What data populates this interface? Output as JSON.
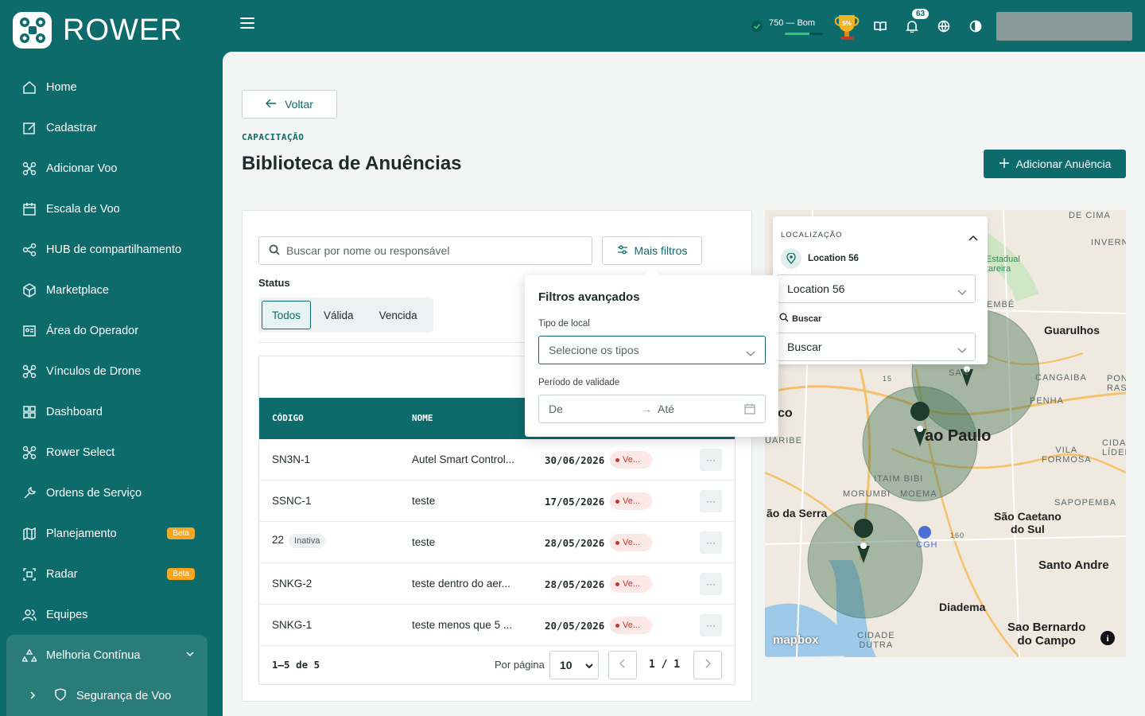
{
  "app": {
    "logo_text": "ROWER"
  },
  "sidebar": {
    "items": [
      {
        "label": "Home",
        "icon": "home-icon"
      },
      {
        "label": "Cadastrar",
        "icon": "edit-icon"
      },
      {
        "label": "Adicionar Voo",
        "icon": "drone-icon"
      },
      {
        "label": "Escala de Voo",
        "icon": "calendar-icon"
      },
      {
        "label": "HUB de compartilhamento",
        "icon": "share-icon"
      },
      {
        "label": "Marketplace",
        "icon": "box-icon"
      },
      {
        "label": "Área do Operador",
        "icon": "id-card-icon"
      },
      {
        "label": "Vínculos de Drone",
        "icon": "drone-icon"
      },
      {
        "label": "Dashboard",
        "icon": "grid-icon"
      },
      {
        "label": "Rower Select",
        "icon": "drone-icon"
      },
      {
        "label": "Ordens de Serviço",
        "icon": "wrench-icon"
      },
      {
        "label": "Planejamento",
        "icon": "map-icon",
        "badge": "Beta"
      },
      {
        "label": "Radar",
        "icon": "radar-icon",
        "badge": "Beta"
      },
      {
        "label": "Equipes",
        "icon": "users-icon"
      }
    ],
    "group": {
      "label": "Melhoria Contínua",
      "sub_item": "Segurança de Voo"
    }
  },
  "topbar": {
    "score_text": "750 — Bom",
    "score_fraction": 0.65,
    "trophy_text": "5%",
    "notifications_count": "63"
  },
  "main": {
    "back_label": "Voltar",
    "eyebrow": "CAPACITAÇÃO",
    "title": "Biblioteca de Anuências",
    "add_label": "Adicionar Anuência",
    "search_placeholder": "Buscar por nome ou responsável",
    "more_filters_label": "Mais filtros",
    "status_label": "Status",
    "status_tabs": [
      "Todos",
      "Válida",
      "Vencida"
    ],
    "table": {
      "headers": [
        "CÓDIGO",
        "NOME"
      ],
      "rows": [
        {
          "code": "SN3N-1",
          "name": "Autel Smart Control...",
          "date": "30/06/2026",
          "status": "Ve..."
        },
        {
          "code": "SSNC-1",
          "name": "teste",
          "date": "17/05/2026",
          "status": "Ve..."
        },
        {
          "code": "22",
          "tag": "Inativa",
          "name": "teste",
          "date": "28/05/2026",
          "status": "Ve..."
        },
        {
          "code": "SNKG-2",
          "name": "teste dentro do aer...",
          "date": "28/05/2026",
          "status": "Ve..."
        },
        {
          "code": "SNKG-1",
          "name": "teste menos que 5 ...",
          "date": "20/05/2026",
          "status": "Ve..."
        }
      ],
      "actions_label": "···"
    },
    "footer": {
      "count": "1–5 de 5",
      "per_page_label": "Por página",
      "per_page": "10",
      "pages": "1 / 1"
    }
  },
  "popover": {
    "title": "Filtros avançados",
    "type_label": "Tipo de local",
    "type_placeholder": "Selecione os tipos",
    "period_label": "Período de validade",
    "from_placeholder": "De",
    "to_placeholder": "Até"
  },
  "map": {
    "panel_eyebrow": "LOCALIZAÇÃO",
    "location_label": "Location 56",
    "location_value": "Location 56",
    "search_label": "Buscar",
    "search_value": "Buscar",
    "labels": {
      "guarulhos": "Guarulhos",
      "sao_paulo": "ao Paulo",
      "sao_caetano": "São Caetano\ndo Sul",
      "santo_andre": "Santo Andre",
      "diadema": "Diadema",
      "sao_bernardo": "Sao Bernardo\ndo Campo",
      "serra": "ão da Serra",
      "co": "co",
      "itaim": "ITAIM BIBI",
      "morumbi": "MORUMBI",
      "moema": "MOEMA",
      "cangaiba": "CANGAIBA",
      "penha": "PENHA",
      "vila_formosa": "VILA\nFORMOSA",
      "sapopemba": "SAPOPEMBA",
      "cidade_dutra": "CIDADE\nDUTRA",
      "cgh": "CGH",
      "de_cima": "DE CIMA",
      "inverno": "INVERN",
      "estadual": "Estadual\ntareira",
      "mapbox": "mapbox",
      "road_15": "15",
      "road_160": "160",
      "san": "SAN",
      "uaribe": "UARIBE",
      "cidade_lider": "CIDAD\nLÍDER",
      "pon": "PON\nRAS",
      "embe": "EMBÉ"
    }
  },
  "colors": {
    "brand": "#0d6b6b",
    "beta": "#f5a623",
    "expired": "#c0392b"
  }
}
